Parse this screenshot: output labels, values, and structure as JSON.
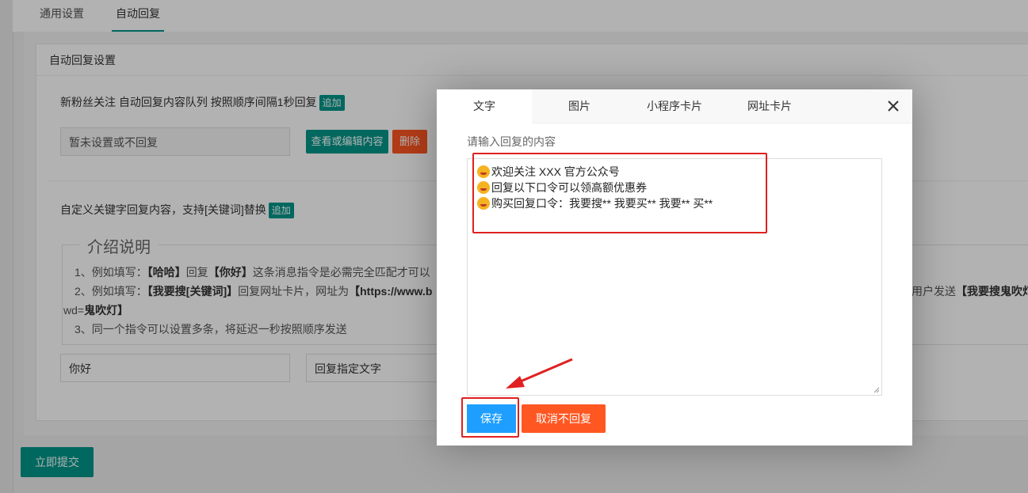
{
  "tabs": {
    "general": "通用设置",
    "auto_reply": "自动回复"
  },
  "card": {
    "title": "自动回复设置"
  },
  "follow": {
    "label": "新粉丝关注 自动回复内容队列 按照顺序间隔1秒回复",
    "add": "追加",
    "input_value": "暂未设置或不回复",
    "edit_button": "查看或编辑内容",
    "delete_button": "删除"
  },
  "keyword": {
    "label": "自定义关键字回复内容，支持[关键词]替换",
    "add": "追加"
  },
  "intro": {
    "legend": "介绍说明",
    "line1_pre": "1、例如填写：",
    "line1_b1": "【哈哈】",
    "line1_mid": "回复",
    "line1_b2": "【你好】",
    "line1_post": "这条消息指令是必需完全匹配才可以",
    "line2_pre": "2、例如填写：",
    "line2_b1": "【我要搜[关键词]】",
    "line2_mid": "回复网址卡片，网址为",
    "line2_b2": "【https://www.b",
    "line2_right_pre": "用户发送",
    "line2_right_b": "【我要搜鬼吹灯】",
    "line2b_pre": "wd=",
    "line2b_b": "鬼吹灯】",
    "line3": "3、同一个指令可以设置多条，将延迟一秒按照顺序发送"
  },
  "rule": {
    "keyword_value": "你好",
    "reply_value": "回复指定文字"
  },
  "submit": "立即提交",
  "modal": {
    "tabs": [
      "文字",
      "图片",
      "小程序卡片",
      "网址卡片"
    ],
    "close_icon": "close-icon",
    "content_label": "请输入回复的内容",
    "lines": [
      "欢迎关注  XXX 官方公众号",
      "回复以下口令可以领高额优惠券",
      "购买回复口令：我要搜**  我要买**  我要**   买**"
    ],
    "save": "保存",
    "cancel": "取消不回复"
  },
  "colors": {
    "primary": "#009688",
    "danger": "#ff5722",
    "save_blue": "#1e9fff",
    "highlight_red": "#e02020"
  }
}
